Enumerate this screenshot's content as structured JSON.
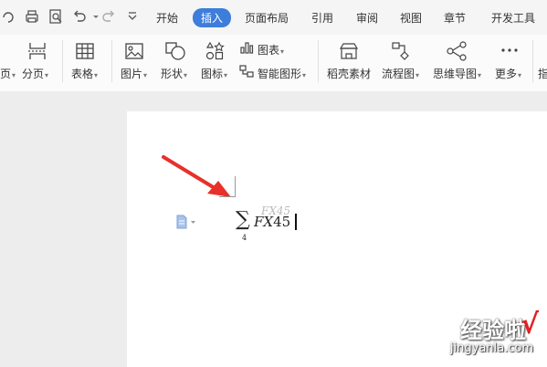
{
  "menu": {
    "tabs": [
      {
        "label": "开始",
        "active": false
      },
      {
        "label": "插入",
        "active": true
      },
      {
        "label": "页面布局",
        "active": false
      },
      {
        "label": "引用",
        "active": false
      },
      {
        "label": "审阅",
        "active": false
      },
      {
        "label": "视图",
        "active": false
      },
      {
        "label": "章节",
        "active": false
      },
      {
        "label": "开发工具",
        "active": false
      }
    ],
    "accent_color": "#3d7ddb"
  },
  "ribbon": {
    "partial_left": "页",
    "page_break": "分页",
    "table": "表格",
    "picture": "图片",
    "shape": "形状",
    "icon": "图标",
    "chart": "图表",
    "smart_art": "智能图形",
    "docer_material": "稻壳素材",
    "flowchart": "流程图",
    "mind_map": "思维导图",
    "more": "更多",
    "partial_right": "指"
  },
  "document": {
    "equation": {
      "symbol": "∑",
      "subscript": "4",
      "body_italic": "FX",
      "body_number": "45",
      "ghost": "FX45"
    }
  },
  "watermark": {
    "brand": "经验啦",
    "check": "√",
    "url": "jingyanla.com"
  }
}
